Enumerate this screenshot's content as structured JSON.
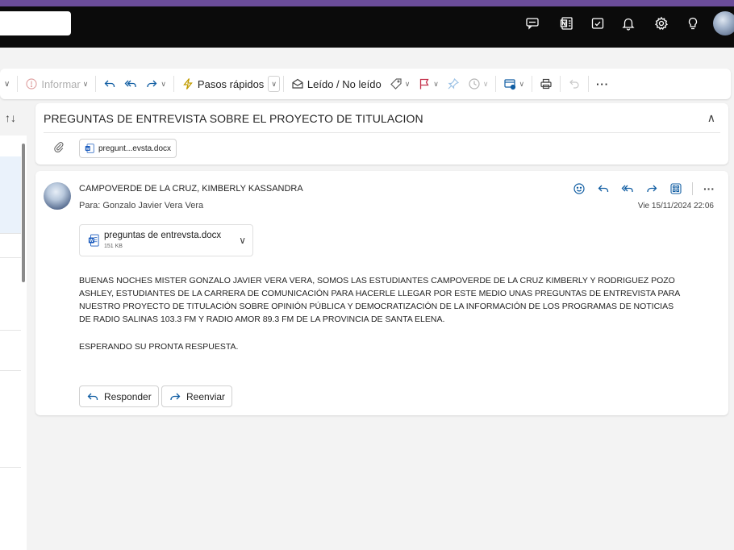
{
  "topbar": {
    "icons": [
      "chat-icon",
      "onenote-icon",
      "todo-icon",
      "bell-icon",
      "gear-icon",
      "lightbulb-icon"
    ]
  },
  "toolbar": {
    "report_label": "Informar",
    "quick_steps_label": "Pasos rápidos",
    "read_unread_label": "Leído / No leído",
    "more_label": "···"
  },
  "subject": {
    "title": "PREGUNTAS DE ENTREVISTA SOBRE EL PROYECTO DE TITULACION",
    "attachment_chip": "pregunt...evsta.docx"
  },
  "message": {
    "sender": "CAMPOVERDE DE LA CRUZ, KIMBERLY KASSANDRA",
    "to_label": "Para:",
    "to_name": "Gonzalo Javier Vera Vera",
    "date": "Vie 15/11/2024 22:06",
    "attachment": {
      "name": "preguntas de entrevsta.docx",
      "size": "151 KB"
    },
    "body_lines": [
      "BUENAS NOCHES MISTER GONZALO JAVIER VERA VERA, SOMOS LAS ESTUDIANTES CAMPOVERDE DE LA CRUZ KIMBERLY Y RODRIGUEZ POZO",
      "ASHLEY, ESTUDIANTES DE LA CARRERA DE COMUNICACIÓN PARA HACERLE LLEGAR POR ESTE MEDIO UNAS PREGUNTAS DE ENTREVISTA PARA",
      "NUESTRO PROYECTO DE TITULACIÓN SOBRE OPINIÓN PÚBLICA Y DEMOCRATIZACIÓN DE LA INFORMACIÓN DE LOS PROGRAMAS DE NOTICIAS",
      "DE RADIO SALINAS 103.3 FM Y RADIO AMOR 89.3 FM DE LA PROVINCIA DE SANTA ELENA."
    ],
    "closing": "ESPERANDO SU PRONTA RESPUESTA.",
    "reply_label": "Responder",
    "forward_label": "Reenviar"
  },
  "colors": {
    "accent": "#115ea3",
    "purple_strip": "#6b4d9a",
    "topbar": "#0b0b0b",
    "word_blue": "#185abd"
  }
}
